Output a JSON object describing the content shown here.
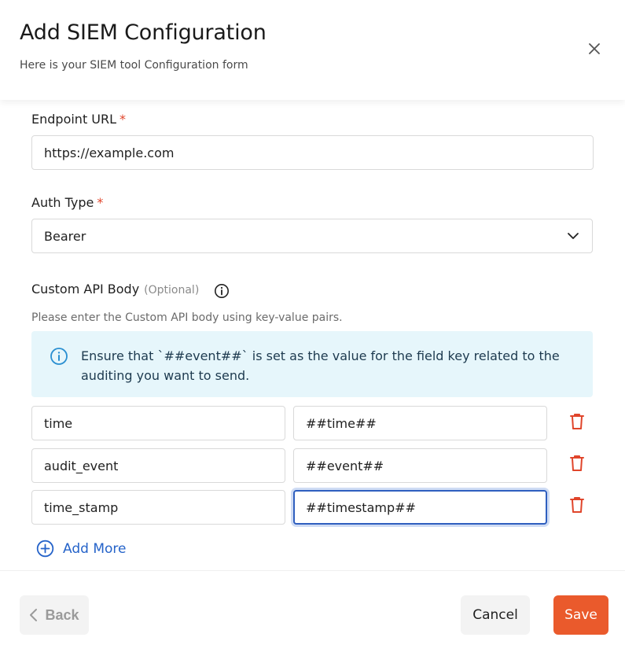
{
  "dialog": {
    "title": "Add SIEM Configuration",
    "subtitle": "Here is your SIEM tool Configuration form"
  },
  "form": {
    "endpoint": {
      "label": "Endpoint URL",
      "required_mark": "*",
      "value": "https://example.com"
    },
    "auth_type": {
      "label": "Auth Type",
      "required_mark": "*",
      "selected": "Bearer"
    },
    "custom_body": {
      "label": "Custom API Body",
      "optional_text": "(Optional)",
      "helper": "Please enter the Custom API body using key-value pairs.",
      "info_message": "Ensure that `##event##` is set as the value for the field key related to the auditing you want to send.",
      "pairs": [
        {
          "key": "time",
          "value": "##time##"
        },
        {
          "key": "audit_event",
          "value": "##event##"
        },
        {
          "key": "time_stamp",
          "value": "##timestamp##"
        }
      ],
      "add_more_label": "Add More"
    }
  },
  "footer": {
    "back_label": "Back",
    "cancel_label": "Cancel",
    "save_label": "Save"
  },
  "colors": {
    "accent": "#ea5a2c",
    "link": "#2563c9",
    "required": "#e0452b",
    "delete": "#e0452b",
    "info_bg": "#e6f6fb",
    "info_icon": "#2a8fd1"
  },
  "icons": {
    "close": "close-icon",
    "dropdown": "chevron-down-icon",
    "info": "info-icon",
    "delete": "trash-icon",
    "add": "plus-circle-icon",
    "back": "chevron-left-icon"
  }
}
